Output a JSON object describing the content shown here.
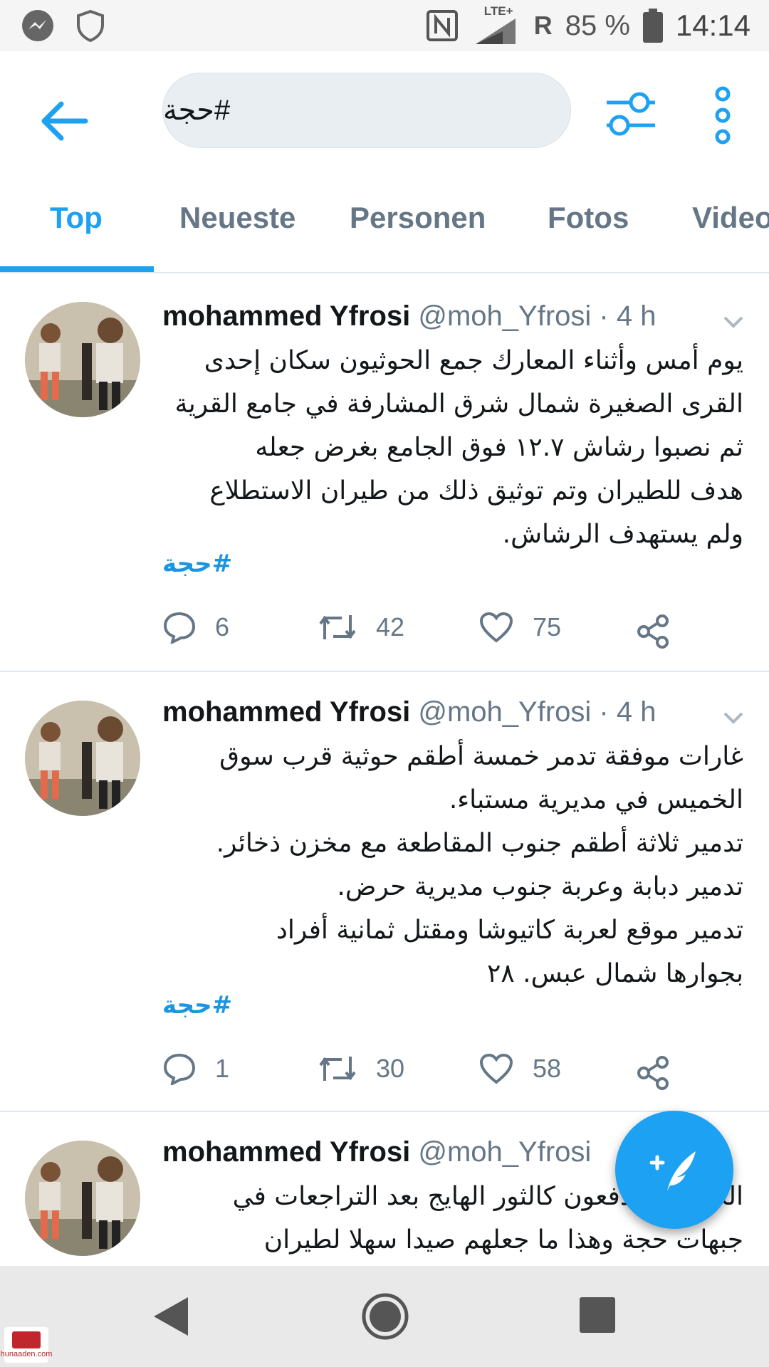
{
  "status_bar": {
    "network": "LTE+",
    "roaming": "R",
    "battery_percent": "85 %",
    "time": "14:14",
    "icons": [
      "messenger-icon",
      "shield-icon",
      "nfc-icon",
      "signal-icon",
      "battery-icon"
    ]
  },
  "header": {
    "search_value": "#حجة",
    "icons": [
      "back-arrow-icon",
      "filter-sliders-icon",
      "more-vertical-icon"
    ]
  },
  "tabs": [
    {
      "label": "Top",
      "active": true
    },
    {
      "label": "Neueste",
      "active": false
    },
    {
      "label": "Personen",
      "active": false
    },
    {
      "label": "Fotos",
      "active": false
    },
    {
      "label": "Video",
      "active": false
    }
  ],
  "tweets": [
    {
      "name": "mohammed Yfrosi",
      "meta": "@moh_Yfrosi · 4 h",
      "lines": [
        "يوم أمس وأثناء المعارك جمع الحوثيون سكان إحدى",
        "القرى الصغيرة شمال شرق المشارفة في جامع القرية",
        "ثم نصبوا رشاش ١٢.٧  فوق الجامع بغرض جعله",
        "هدف للطيران وتم توثيق ذلك من طيران الاستطلاع",
        "ولم يستهدف الرشاش."
      ],
      "hashtag": "#حجة",
      "replies": "6",
      "retweets": "42",
      "likes": "75"
    },
    {
      "name": "mohammed Yfrosi",
      "meta": "@moh_Yfrosi · 4 h",
      "lines": [
        "غارات موفقة تدمر خمسة أطقم حوثية قرب سوق",
        "الخميس في مديرية مستباء.",
        "تدمير ثلاثة أطقم جنوب المقاطعة مع مخزن ذخائر.",
        "تدمير دبابة وعربة جنوب مديرية حرض.",
        "تدمير موقع لعربة كاتيوشا ومقتل ثمانية أفراد",
        "بجوارها شمال عبس. ٢٨"
      ],
      "hashtag": "#حجة",
      "replies": "1",
      "retweets": "30",
      "likes": "58"
    },
    {
      "name": "mohammed Yfrosi",
      "meta": "@moh_Yfrosi",
      "lines": [
        "الحوثيين يندفعون كالثور الهايج بعد التراجعات في",
        "جبهات حجة وهذا ما جعلهم صيدا سهلا لطيران"
      ]
    }
  ],
  "fab": {
    "icon": "compose-feather-icon"
  },
  "nav": {
    "icons": [
      "nav-back-icon",
      "nav-home-icon",
      "nav-recents-icon"
    ]
  },
  "watermark": {
    "text": "hunaaden.com"
  }
}
